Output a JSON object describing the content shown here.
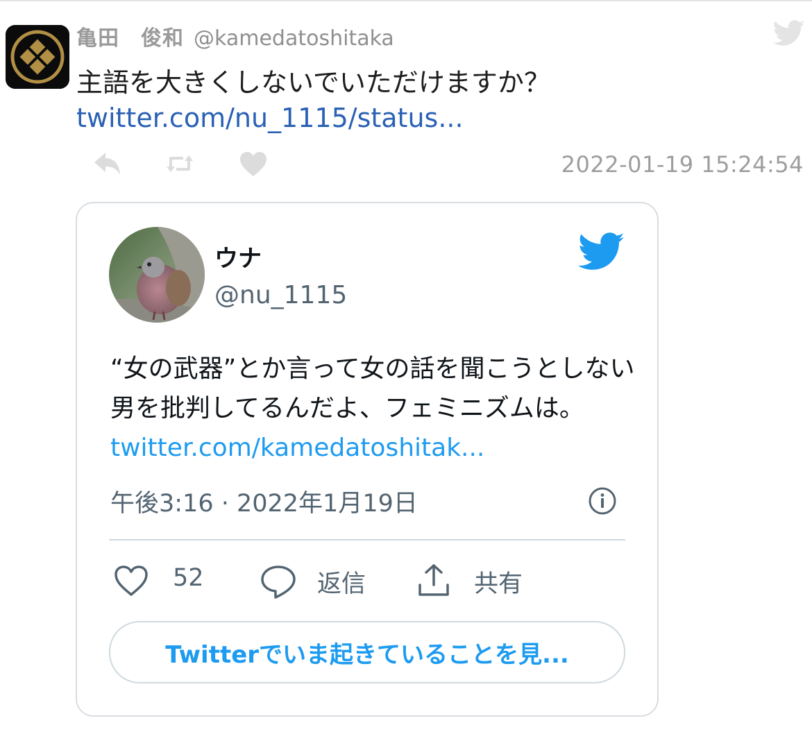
{
  "tweet": {
    "author_name": "亀田　俊和",
    "author_handle": "@kamedatoshitaka",
    "text": "主語を大きくしないでいただけますか？",
    "link": "twitter.com/nu_1115/status...",
    "timestamp": "2022-01-19 15:24:54",
    "actions": [
      "reply",
      "retweet",
      "like"
    ]
  },
  "embed": {
    "name": "ウナ",
    "handle": "@nu_1115",
    "text": "“女の武器”とか言って女の話を聞こうとしない男を批判してるんだよ、フェミニズムは。",
    "link": "twitter.com/kamedatoshitak...",
    "time": "午後3:16 · 2022年1月19日",
    "likes": "52",
    "reply_label": "返信",
    "share_label": "共有",
    "cta": "Twitterでいま起きていることを見..."
  },
  "colors": {
    "link_outer": "#2a61b4",
    "twitter_blue": "#1d9bf0",
    "muted": "#536471",
    "emblem_gold": "#b18f45"
  },
  "icons": [
    "twitter-bird-icon",
    "reply-icon",
    "retweet-icon",
    "heart-icon",
    "info-icon",
    "comment-icon",
    "share-icon"
  ]
}
